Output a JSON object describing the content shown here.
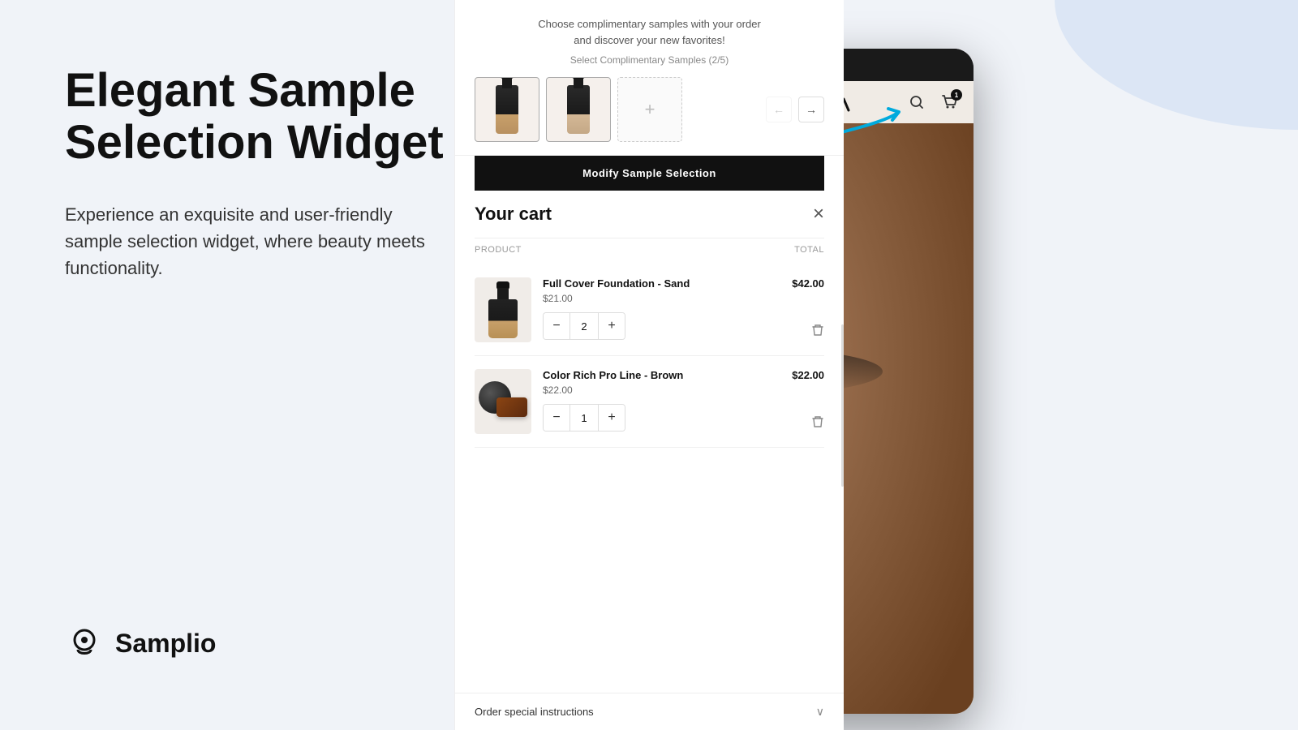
{
  "background": {
    "color": "#f0f3f8"
  },
  "left_panel": {
    "main_title": "Elegant Sample Selection Widget",
    "subtitle": "Experience an exquisite and user-friendly sample selection widget, where beauty meets functionality.",
    "logo_text": "Samplio"
  },
  "samples_section": {
    "header_line1": "Choose complimentary samples with your order",
    "header_line2": "and discover your new favorites!",
    "count_label": "Select Complimentary Samples (2/5)",
    "samples": [
      {
        "id": "sample-1",
        "type": "bottle-dark",
        "selected": true
      },
      {
        "id": "sample-2",
        "type": "bottle-light",
        "selected": true
      }
    ],
    "add_slot_icon": "+",
    "nav_next": "→",
    "nav_prev_disabled": true
  },
  "modify_button": {
    "label": "Modify Sample Selection"
  },
  "cart": {
    "title": "Your cart",
    "close_icon": "×",
    "columns": {
      "product": "PRODUCT",
      "total": "TOTAL"
    },
    "items": [
      {
        "id": "item-1",
        "name": "Full Cover Foundation - Sand",
        "price": "$21.00",
        "total": "$42.00",
        "quantity": 2
      },
      {
        "id": "item-2",
        "name": "Color Rich Pro Line - Brown",
        "price": "$22.00",
        "total": "$22.00",
        "quantity": 1
      }
    ],
    "instructions_label": "Order special instructions",
    "chevron": "∨"
  },
  "store_header": {
    "cart_count": "1"
  }
}
